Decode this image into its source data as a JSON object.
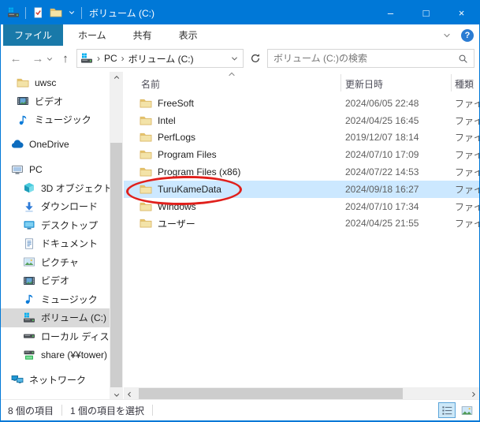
{
  "colors": {
    "accent": "#0078d7",
    "file_tab": "#1979a9",
    "row_selection": "#cce8ff",
    "sidebar_selection": "#d9d9d9",
    "annotation": "#e0201c"
  },
  "window": {
    "title": "ボリューム (C:)",
    "qat": [
      {
        "icon": "drive"
      },
      {
        "icon": "properties"
      },
      {
        "icon": "folder"
      },
      {
        "icon": "chevron-down"
      }
    ],
    "controls": [
      {
        "name": "minimize",
        "glyph": "–"
      },
      {
        "name": "maximize",
        "glyph": "□"
      },
      {
        "name": "close",
        "glyph": "×"
      }
    ]
  },
  "ribbon": {
    "tabs": [
      {
        "label": "ファイル",
        "active": true
      },
      {
        "label": "ホーム"
      },
      {
        "label": "共有"
      },
      {
        "label": "表示"
      }
    ],
    "help_glyph": "?"
  },
  "navbar": {
    "back_glyph": "←",
    "forward_glyph": "→",
    "up_glyph": "↑",
    "breadcrumb": {
      "icon": "drive",
      "items": [
        {
          "sep": "›",
          "label": "PC"
        },
        {
          "sep": "›",
          "label": "ボリューム (C:)"
        }
      ]
    },
    "search": {
      "placeholder": "ボリューム (C:)の検索"
    }
  },
  "sidebar": {
    "items": [
      {
        "label": "uwsc",
        "icon": "folder",
        "level": 2
      },
      {
        "label": "ビデオ",
        "icon": "video",
        "level": 2
      },
      {
        "label": "ミュージック",
        "icon": "music",
        "level": 2
      },
      {
        "label": "OneDrive",
        "icon": "cloud",
        "level": 1,
        "gap_before": true
      },
      {
        "label": "PC",
        "icon": "pc",
        "level": 1,
        "gap_before": true
      },
      {
        "label": "3D オブジェクト",
        "icon": "cube",
        "level": 3
      },
      {
        "label": "ダウンロード",
        "icon": "download",
        "level": 3
      },
      {
        "label": "デスクトップ",
        "icon": "desktop",
        "level": 3
      },
      {
        "label": "ドキュメント",
        "icon": "document",
        "level": 3
      },
      {
        "label": "ピクチャ",
        "icon": "picture",
        "level": 3
      },
      {
        "label": "ビデオ",
        "icon": "video",
        "level": 3
      },
      {
        "label": "ミュージック",
        "icon": "music",
        "level": 3
      },
      {
        "label": "ボリューム (C:)",
        "icon": "drive",
        "level": 3,
        "selected": true
      },
      {
        "label": "ローカル ディスク (D",
        "icon": "drive-plain",
        "level": 3
      },
      {
        "label": "share (¥¥tower) (",
        "icon": "drive-network",
        "level": 3
      },
      {
        "label": "ネットワーク",
        "icon": "network",
        "level": 1,
        "gap_before": true
      }
    ]
  },
  "filelist": {
    "columns": [
      {
        "label": "名前",
        "sort": "asc"
      },
      {
        "label": "更新日時"
      },
      {
        "label": "種類"
      }
    ],
    "rows": [
      {
        "name": "FreeSoft",
        "modified": "2024/06/05 22:48",
        "type": "ファイ",
        "icon": "folder"
      },
      {
        "name": "Intel",
        "modified": "2024/04/25 16:45",
        "type": "ファイ",
        "icon": "folder"
      },
      {
        "name": "PerfLogs",
        "modified": "2019/12/07 18:14",
        "type": "ファイ",
        "icon": "folder"
      },
      {
        "name": "Program Files",
        "modified": "2024/07/10 17:09",
        "type": "ファイ",
        "icon": "folder"
      },
      {
        "name": "Program Files (x86)",
        "modified": "2024/07/22 14:53",
        "type": "ファイ",
        "icon": "folder"
      },
      {
        "name": "TuruKameData",
        "modified": "2024/09/18 16:27",
        "type": "ファイ",
        "icon": "folder",
        "selected": true,
        "annotated": true
      },
      {
        "name": "Windows",
        "modified": "2024/07/10 17:34",
        "type": "ファイ",
        "icon": "folder"
      },
      {
        "name": "ユーザー",
        "modified": "2024/04/25 21:55",
        "type": "ファイ",
        "icon": "folder"
      }
    ]
  },
  "statusbar": {
    "item_count": "8 個の項目",
    "selection_count": "1 個の項目を選択"
  }
}
